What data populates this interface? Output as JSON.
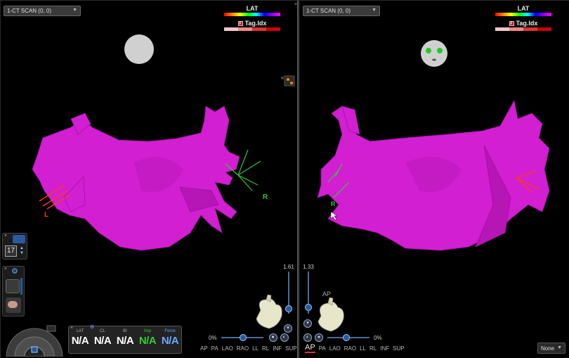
{
  "left_view": {
    "scan_select": "1-CT SCAN (0, 0)",
    "lat_label": "LAT",
    "tag_label": "Tag.Idx",
    "orientation_labels": [
      "L",
      "R"
    ],
    "zoom_value": "1.61",
    "zoom_percent": "0%",
    "view_buttons": [
      "AP",
      "PA",
      "LAO",
      "RAO",
      "LL",
      "RL",
      "INF",
      "SUP"
    ]
  },
  "right_view": {
    "scan_select": "1-CT SCAN (0, 0)",
    "lat_label": "LAT",
    "tag_label": "Tag.Idx",
    "orientation_label": "R",
    "zoom_value": "1.33",
    "zoom_percent": "0%",
    "heart_caption": "AP",
    "view_buttons": [
      "AP",
      "PA",
      "LAO",
      "RAO",
      "LL",
      "RL",
      "INF",
      "SUP"
    ],
    "active_view": "AP",
    "none_select": "None"
  },
  "left_toolbox": {
    "number_value": "17"
  },
  "status": {
    "items": [
      {
        "label": "LAT",
        "value": "N/A",
        "color": "white"
      },
      {
        "label": "CL",
        "value": "N/A",
        "color": "white"
      },
      {
        "label": "BI",
        "value": "N/A",
        "color": "white"
      },
      {
        "label": "Imp",
        "value": "N/A",
        "color": "green"
      },
      {
        "label": "Force",
        "value": "N/A",
        "color": "blue"
      }
    ]
  },
  "colors": {
    "anatomy": "#d21fd2",
    "anatomy_dark": "#8a0f8a",
    "ui_panel": "#232323",
    "accent_blue": "#2a5a9a"
  },
  "icons": [
    "chevron-down-icon",
    "close-icon",
    "gear-icon",
    "heart-icon",
    "face-icon"
  ]
}
